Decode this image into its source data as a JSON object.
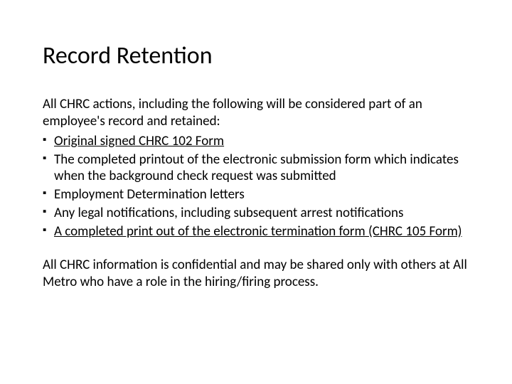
{
  "title": "Record Retention",
  "intro": "All CHRC actions, including the following will be considered part of an employee's record and retained:",
  "bullets": {
    "b0": "Original signed CHRC 102 Form",
    "b1": "The completed printout of the electronic submission form which indicates when the background check request was submitted",
    "b2": "Employment Determination letters",
    "b3": "Any legal notifications, including subsequent arrest notifications",
    "b4": "A completed print out of the electronic termination form (CHRC 105 Form)"
  },
  "closing": "All CHRC information is confidential and may be shared only with others at All Metro who have a role in the hiring/firing process."
}
